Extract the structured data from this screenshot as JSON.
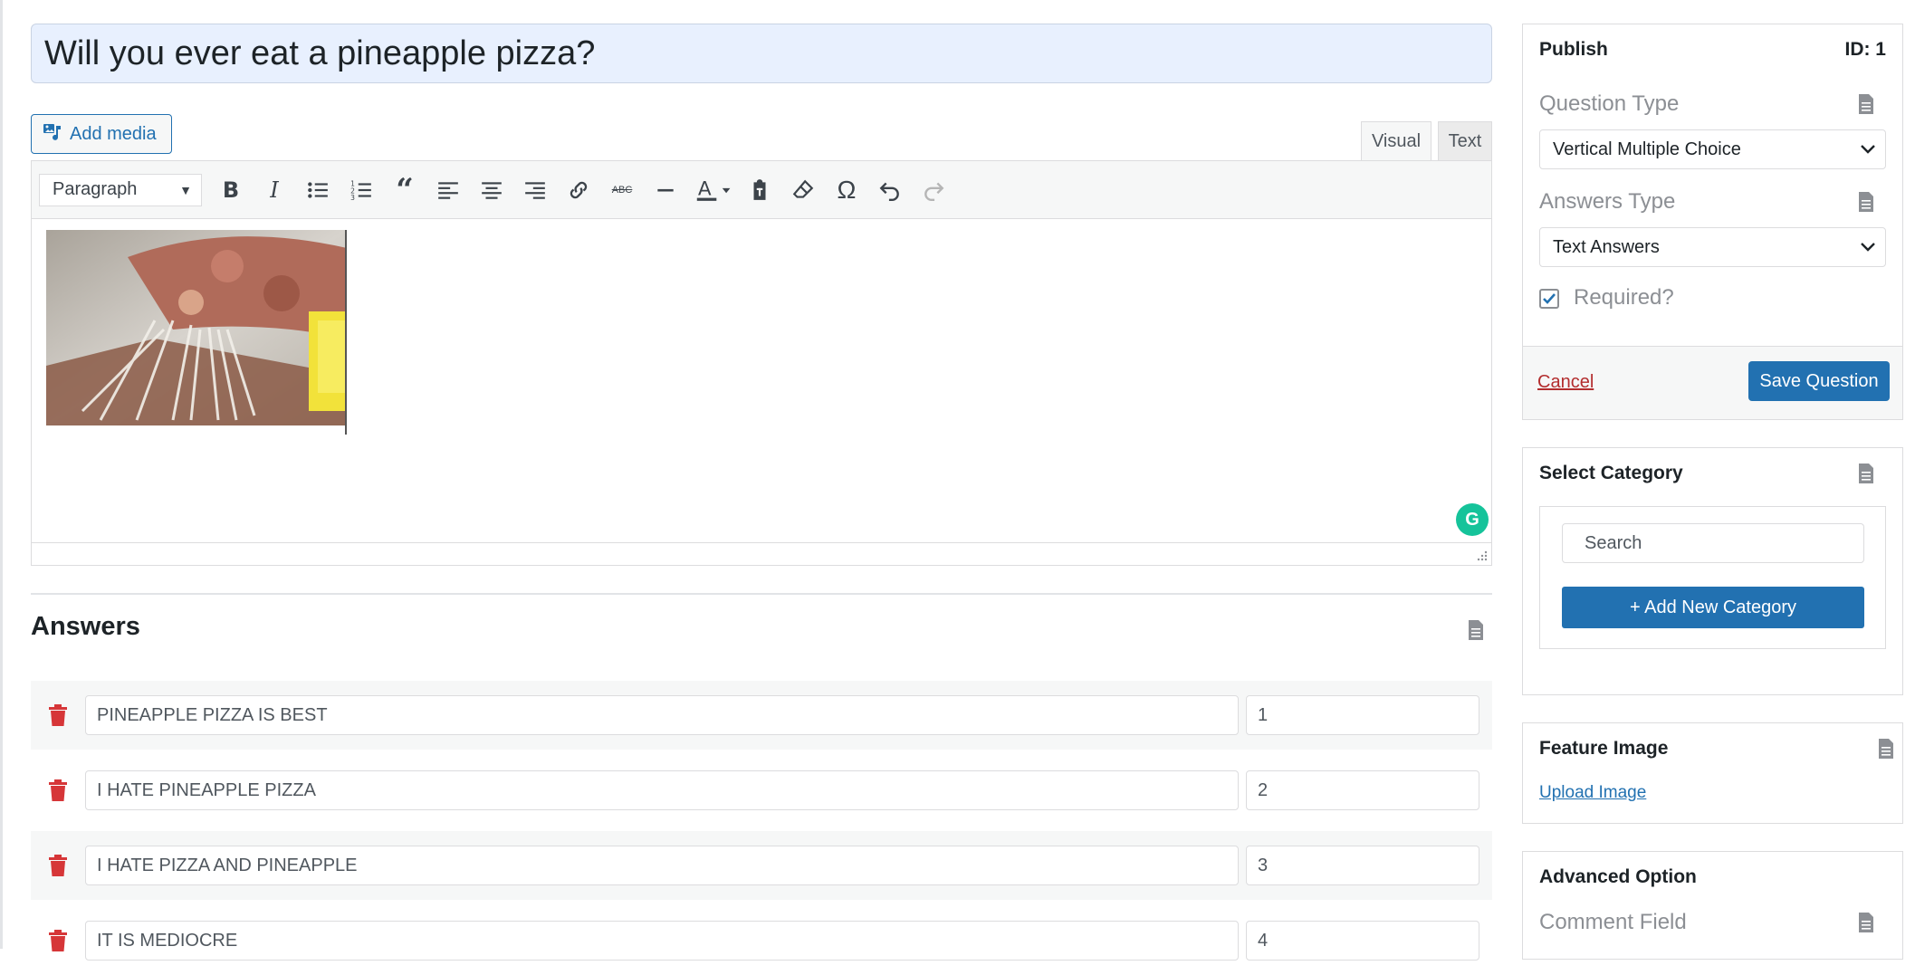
{
  "question": {
    "title": "Will you ever eat a pineapple pizza?"
  },
  "editor": {
    "add_media_label": "Add media",
    "tabs": {
      "visual": "Visual",
      "text": "Text"
    },
    "format_select": "Paragraph",
    "toolbar_icons": [
      "bold-icon",
      "italic-icon",
      "bullet-list-icon",
      "numbered-list-icon",
      "blockquote-icon",
      "align-left-icon",
      "align-center-icon",
      "align-right-icon",
      "link-icon",
      "strikethrough-icon",
      "horizontal-line-icon",
      "text-color-icon",
      "paste-text-icon",
      "clear-formatting-icon",
      "special-character-icon",
      "undo-icon",
      "redo-icon"
    ]
  },
  "answers": {
    "title": "Answers",
    "items": [
      {
        "text": "PINEAPPLE PIZZA IS BEST",
        "weight": "1"
      },
      {
        "text": "I HATE PINEAPPLE PIZZA",
        "weight": "2"
      },
      {
        "text": "I HATE PIZZA AND PINEAPPLE",
        "weight": "3"
      },
      {
        "text": "IT IS MEDIOCRE",
        "weight": "4"
      }
    ]
  },
  "publish": {
    "title": "Publish",
    "id_label": "ID: 1",
    "question_type_label": "Question Type",
    "question_type_value": "Vertical Multiple Choice",
    "answers_type_label": "Answers Type",
    "answers_type_value": "Text Answers",
    "required_label": "Required?",
    "required_checked": true,
    "cancel_label": "Cancel",
    "save_label": "Save Question"
  },
  "category": {
    "title": "Select Category",
    "search_placeholder": "Search",
    "add_button": "+ Add New Category"
  },
  "feature_image": {
    "title": "Feature Image",
    "upload_label": "Upload Image"
  },
  "advanced": {
    "title": "Advanced Option",
    "comment_field_label": "Comment Field"
  },
  "colors": {
    "accent": "#2271b1",
    "danger": "#d63638",
    "title_bg": "#e8f0fe",
    "grammarly": "#15c39a"
  }
}
